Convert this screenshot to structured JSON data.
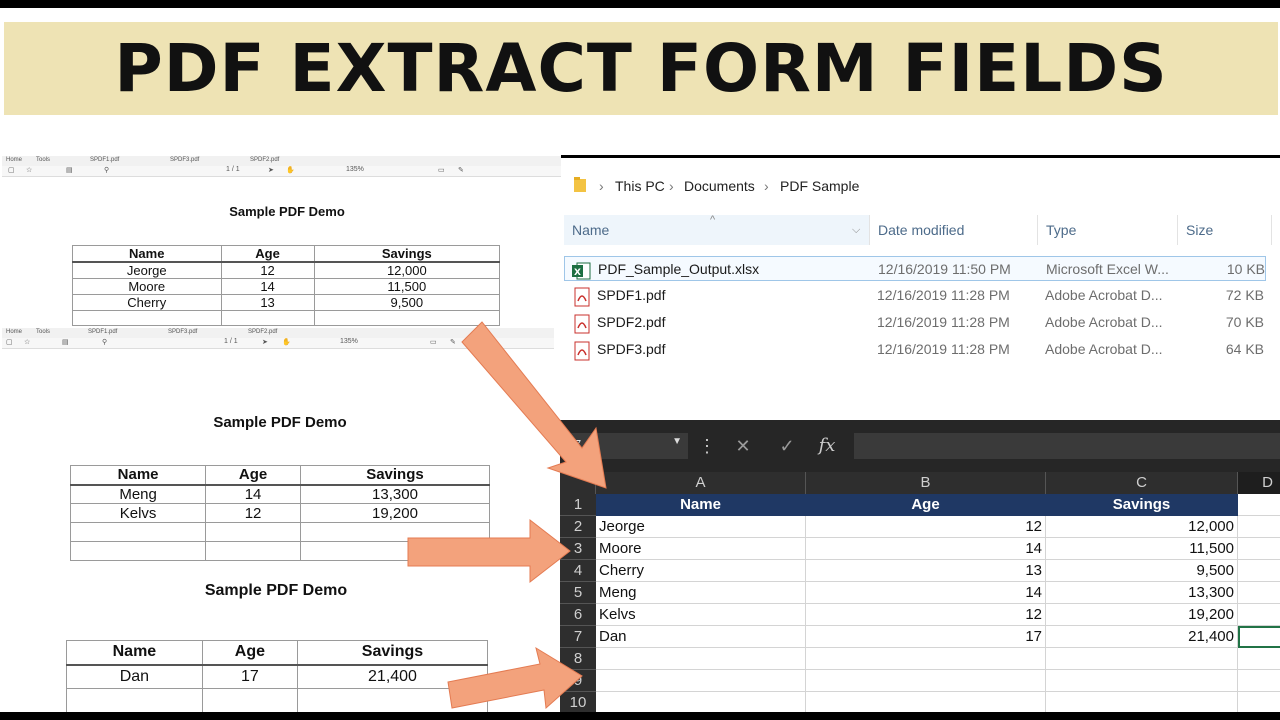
{
  "banner": {
    "title": "PDF EXTRACT FORM FIELDS"
  },
  "pdf_tab_labels": {
    "home": "Home",
    "tools": "Tools"
  },
  "pdf_viewers": [
    {
      "tabs": [
        "SPDF1.pdf",
        "SPDF3.pdf",
        "SPDF2.pdf"
      ],
      "page": "1 / 1",
      "zoom": "135%",
      "title": "Sample PDF Demo",
      "headers": [
        "Name",
        "Age",
        "Savings"
      ],
      "rows": [
        [
          "Jeorge",
          "12",
          "12,000"
        ],
        [
          "Moore",
          "14",
          "11,500"
        ],
        [
          "Cherry",
          "13",
          "9,500"
        ]
      ]
    },
    {
      "tabs": [
        "SPDF1.pdf",
        "SPDF3.pdf",
        "SPDF2.pdf"
      ],
      "page": "1 / 1",
      "zoom": "135%",
      "title": "Sample PDF Demo",
      "headers": [
        "Name",
        "Age",
        "Savings"
      ],
      "rows": [
        [
          "Meng",
          "14",
          "13,300"
        ],
        [
          "Kelvs",
          "12",
          "19,200"
        ]
      ]
    },
    {
      "title": "Sample PDF Demo",
      "headers": [
        "Name",
        "Age",
        "Savings"
      ],
      "rows": [
        [
          "Dan",
          "17",
          "21,400"
        ]
      ]
    }
  ],
  "explorer": {
    "breadcrumb": [
      "This PC",
      "Documents",
      "PDF Sample"
    ],
    "columns": [
      "Name",
      "Date modified",
      "Type",
      "Size"
    ],
    "files": [
      {
        "name": "PDF_Sample_Output.xlsx",
        "date": "12/16/2019 11:50 PM",
        "type": "Microsoft Excel W...",
        "size": "10 KB",
        "icon": "excel-file-icon"
      },
      {
        "name": "SPDF1.pdf",
        "date": "12/16/2019 11:28 PM",
        "type": "Adobe Acrobat D...",
        "size": "72 KB",
        "icon": "pdf-file-icon"
      },
      {
        "name": "SPDF2.pdf",
        "date": "12/16/2019 11:28 PM",
        "type": "Adobe Acrobat D...",
        "size": "70 KB",
        "icon": "pdf-file-icon"
      },
      {
        "name": "SPDF3.pdf",
        "date": "12/16/2019 11:28 PM",
        "type": "Adobe Acrobat D...",
        "size": "64 KB",
        "icon": "pdf-file-icon"
      }
    ]
  },
  "excel": {
    "name_box": "7",
    "formula_buttons": {
      "cancel": "✕",
      "enter": "✓",
      "fx": "fx"
    },
    "columns": [
      "A",
      "B",
      "C",
      "D"
    ],
    "headers": [
      "Name",
      "Age",
      "Savings"
    ],
    "rows": [
      [
        "Jeorge",
        "12",
        "12,000"
      ],
      [
        "Moore",
        "14",
        "11,500"
      ],
      [
        "Cherry",
        "13",
        "9,500"
      ],
      [
        "Meng",
        "14",
        "13,300"
      ],
      [
        "Kelvs",
        "12",
        "19,200"
      ],
      [
        "Dan",
        "17",
        "21,400"
      ]
    ],
    "row_numbers": [
      "1",
      "2",
      "3",
      "4",
      "5",
      "6",
      "7",
      "8",
      "9",
      "10"
    ]
  },
  "colors": {
    "banner": "#eee3b4",
    "excel_header": "#1f3864",
    "arrow": "#f3a27c"
  }
}
